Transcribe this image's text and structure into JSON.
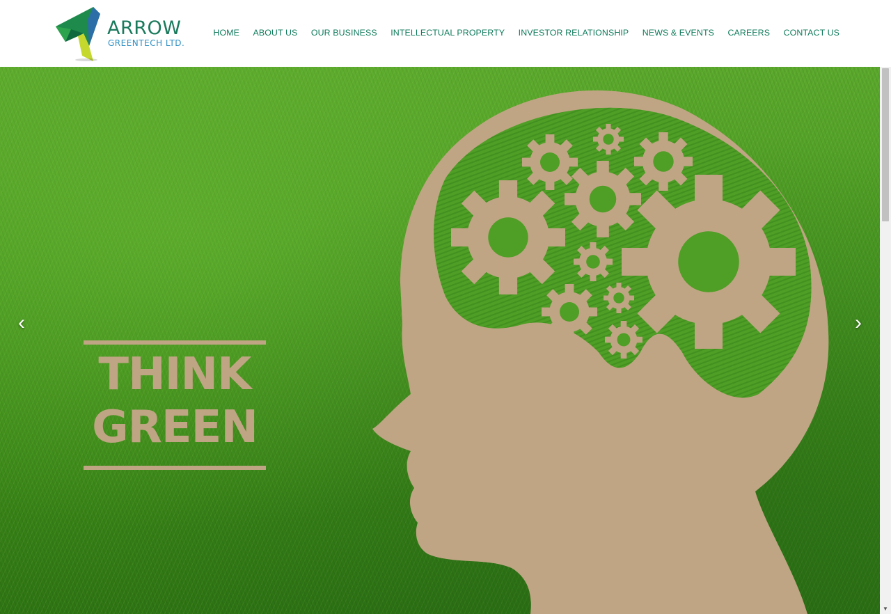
{
  "brand": {
    "name": "ARROW",
    "subtitle": "GREENTECH LTD.",
    "colors": {
      "primary": "#1a7a5c",
      "secondary": "#2f8fc2",
      "accent_yellow": "#c4d82e"
    }
  },
  "nav": {
    "items": [
      {
        "label": "HOME"
      },
      {
        "label": "ABOUT US"
      },
      {
        "label": "OUR BUSINESS"
      },
      {
        "label": "INTELLECTUAL PROPERTY"
      },
      {
        "label": "INVESTOR RELATIONSHIP"
      },
      {
        "label": "NEWS & EVENTS"
      },
      {
        "label": "CAREERS"
      },
      {
        "label": "CONTACT US"
      }
    ],
    "color": "#0d7a5a"
  },
  "hero": {
    "headline_line1": "THINK",
    "headline_line2": "GREEN",
    "prev_icon": "chevron-left-icon",
    "next_icon": "chevron-right-icon",
    "prev_glyph": "‹",
    "next_glyph": "›",
    "colors": {
      "grass": "#4a9a22",
      "silhouette": "#c0a584"
    }
  },
  "scrollbar": {
    "up_glyph": "▲",
    "down_glyph": "▼"
  }
}
